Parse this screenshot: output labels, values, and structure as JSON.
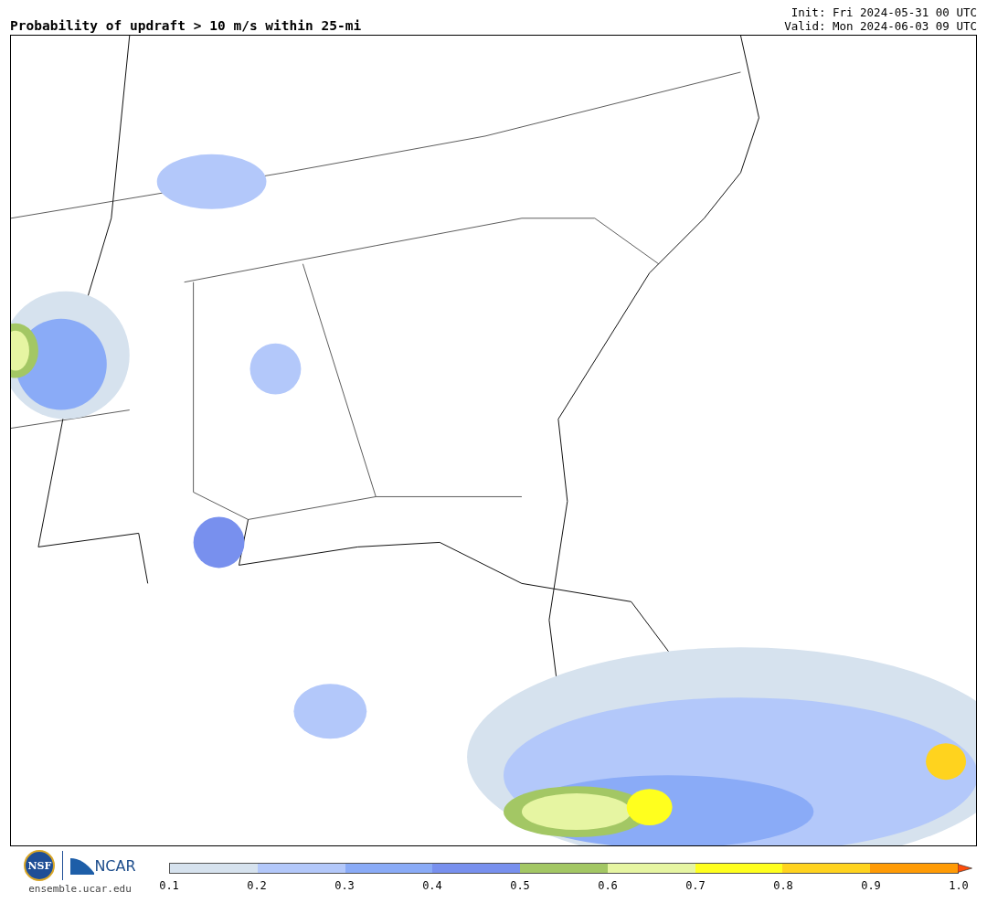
{
  "title": "Probability of updraft > 10 m/s within 25-mi",
  "init": "Init: Fri 2024-05-31 00 UTC",
  "valid": "Valid: Mon 2024-06-03 09 UTC",
  "logos": {
    "nsf": "NSF",
    "ncar": "NCAR",
    "url": "ensemble.ucar.edu"
  },
  "colorbar": {
    "bins": [
      {
        "color": "#d6e2ee"
      },
      {
        "color": "#b3c8fa"
      },
      {
        "color": "#8aabf7"
      },
      {
        "color": "#7890ee"
      },
      {
        "color": "#a3c764"
      },
      {
        "color": "#e6f5a2"
      },
      {
        "color": "#ffff1e"
      },
      {
        "color": "#ffd31e"
      },
      {
        "color": "#ff9b05"
      },
      {
        "color": "#ff4d0a",
        "kind": "arrow"
      }
    ],
    "ticks": [
      "0.1",
      "0.2",
      "0.3",
      "0.4",
      "0.5",
      "0.6",
      "0.7",
      "0.8",
      "0.9",
      "1.0"
    ]
  }
}
